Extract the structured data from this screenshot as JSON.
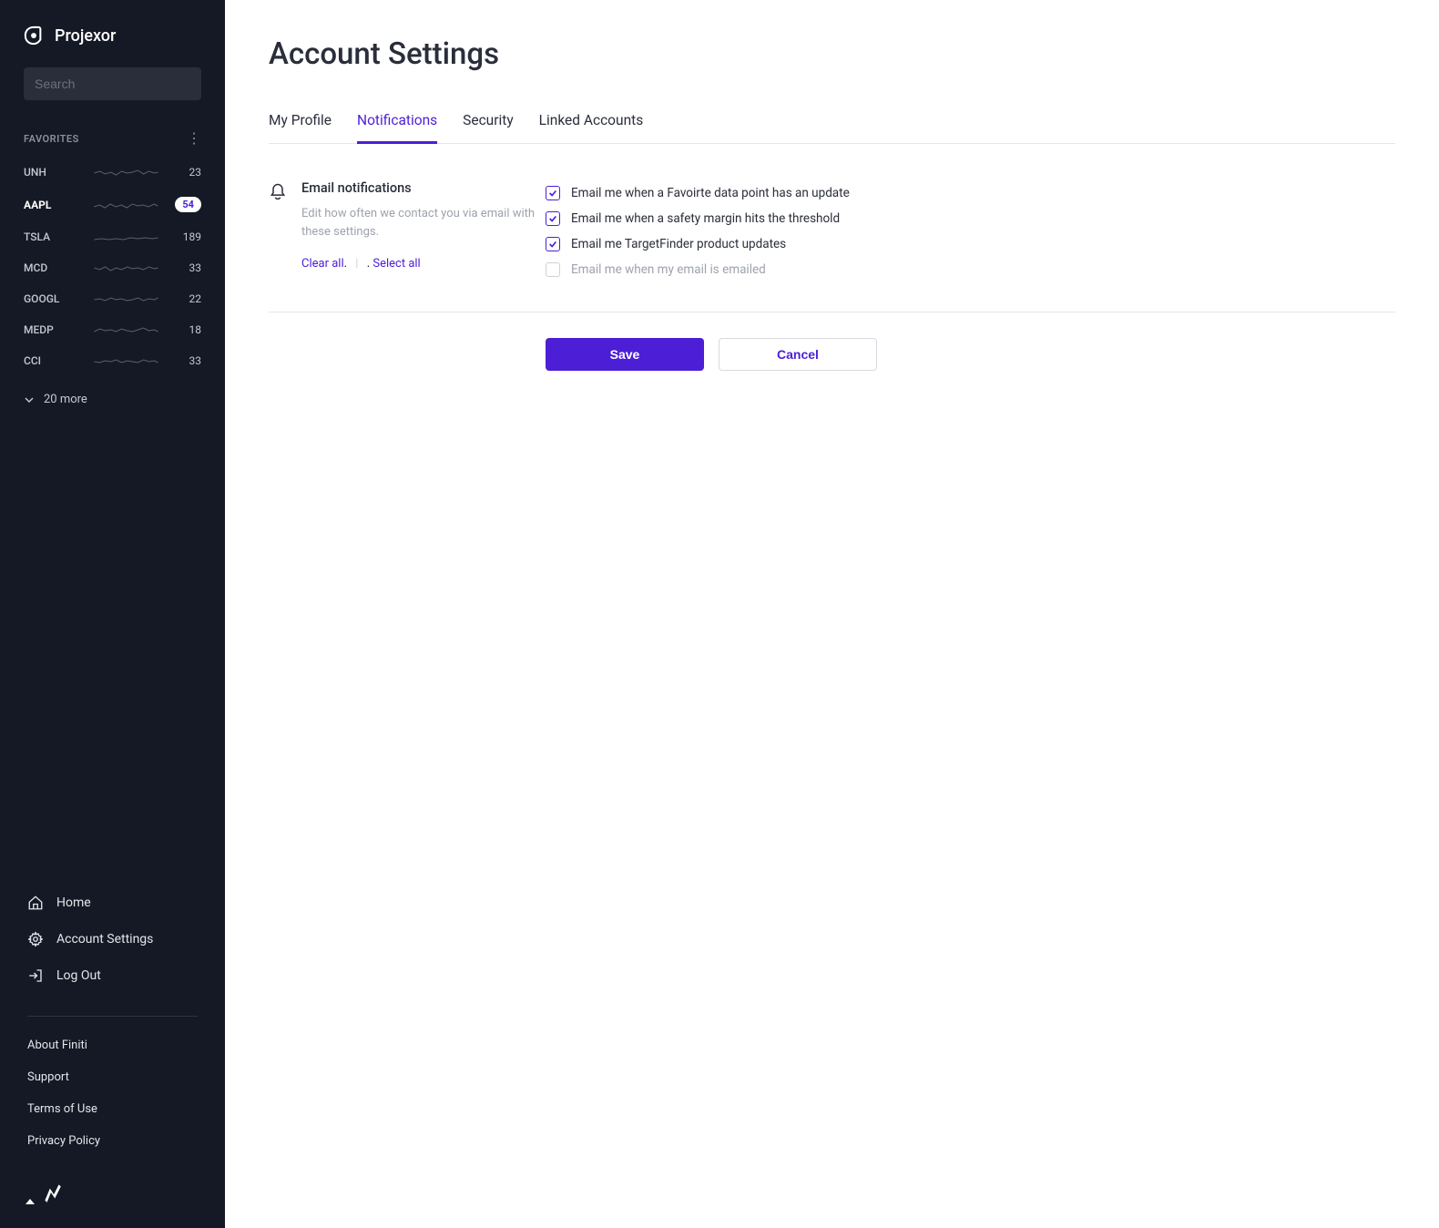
{
  "brand": "Projexor",
  "search": {
    "placeholder": "Search"
  },
  "favorites": {
    "label": "FAVORITES",
    "items": [
      {
        "ticker": "UNH",
        "count": "23",
        "active": false,
        "badge": false
      },
      {
        "ticker": "AAPL",
        "count": "54",
        "active": true,
        "badge": true
      },
      {
        "ticker": "TSLA",
        "count": "189",
        "active": false,
        "badge": false
      },
      {
        "ticker": "MCD",
        "count": "33",
        "active": false,
        "badge": false
      },
      {
        "ticker": "GOOGL",
        "count": "22",
        "active": false,
        "badge": false
      },
      {
        "ticker": "MEDP",
        "count": "18",
        "active": false,
        "badge": false
      },
      {
        "ticker": "CCI",
        "count": "33",
        "active": false,
        "badge": false
      }
    ],
    "more": "20 more"
  },
  "nav": {
    "home": "Home",
    "account": "Account Settings",
    "logout": "Log Out"
  },
  "footer": {
    "about": "About Finiti",
    "support": "Support",
    "terms": "Terms of Use",
    "privacy": "Privacy Policy"
  },
  "page": {
    "title": "Account Settings",
    "tabs": {
      "profile": "My Profile",
      "notifications": "Notifications",
      "security": "Security",
      "linked": "Linked Accounts"
    },
    "section": {
      "title": "Email notifications",
      "desc": "Edit how often we contact you via email with these settings.",
      "clear": "Clear all",
      "select": "Select all"
    },
    "options": [
      {
        "label": "Email me when a Favoirte data point has an update",
        "checked": true
      },
      {
        "label": "Email me when a safety margin hits the threshold",
        "checked": true
      },
      {
        "label": "Email me TargetFinder product updates",
        "checked": true
      },
      {
        "label": "Email me when my email is emailed",
        "checked": false
      }
    ],
    "buttons": {
      "save": "Save",
      "cancel": "Cancel"
    }
  },
  "colors": {
    "accent": "#4c1fd6",
    "sidebar": "#151925"
  }
}
